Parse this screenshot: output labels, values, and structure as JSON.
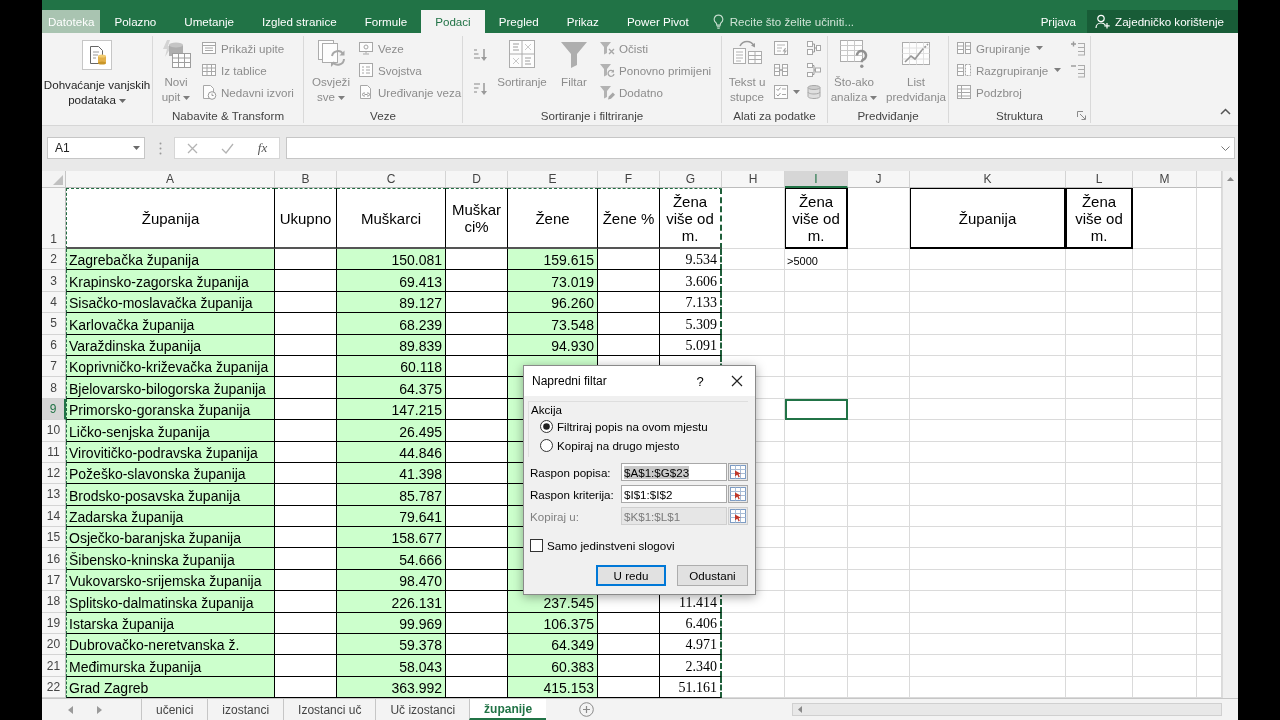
{
  "ribbon_tabs": [
    {
      "label": "Datoteka",
      "kind": "file",
      "selected": false
    },
    {
      "label": "Polazno",
      "kind": "tab",
      "selected": false
    },
    {
      "label": "Umetanje",
      "kind": "tab",
      "selected": false
    },
    {
      "label": "Izgled stranice",
      "kind": "tab",
      "selected": false
    },
    {
      "label": "Formule",
      "kind": "tab",
      "selected": false
    },
    {
      "label": "Podaci",
      "kind": "tab",
      "selected": true
    },
    {
      "label": "Pregled",
      "kind": "tab",
      "selected": false
    },
    {
      "label": "Prikaz",
      "kind": "tab",
      "selected": false
    },
    {
      "label": "Power Pivot",
      "kind": "tab",
      "selected": false
    }
  ],
  "tell_me": {
    "placeholder": "Recite što želite učiniti..."
  },
  "account": {
    "sign_in": "Prijava",
    "share": "Zajedničko korištenje"
  },
  "ribbon": {
    "groups": [
      {
        "dialog_launcher": false,
        "buttons": [
          {
            "kind": "large",
            "label": "Dohvaćanje vanjskih podataka",
            "dropdown": true,
            "disabled": false
          }
        ]
      },
      {
        "label": "Nabavite & Transform",
        "dialog_launcher": false,
        "buttons": [
          {
            "kind": "large",
            "label": "Novi upit",
            "dropdown": true,
            "disabled": true
          },
          {
            "kind": "small",
            "label": "Prikaži upite",
            "dropdown": false,
            "disabled": true
          },
          {
            "kind": "small",
            "label": "Iz tablice",
            "dropdown": false,
            "disabled": true
          },
          {
            "kind": "small",
            "label": "Nedavni izvori",
            "dropdown": false,
            "disabled": true
          }
        ]
      },
      {
        "label": "Veze",
        "dialog_launcher": false,
        "buttons": [
          {
            "kind": "large",
            "label": "Osvježi sve",
            "dropdown": true,
            "disabled": true
          },
          {
            "kind": "small",
            "label": "Veze",
            "dropdown": false,
            "disabled": true
          },
          {
            "kind": "small",
            "label": "Svojstva",
            "dropdown": false,
            "disabled": true
          },
          {
            "kind": "small",
            "label": "Uređivanje veza",
            "dropdown": false,
            "disabled": true
          }
        ]
      },
      {
        "label": "Sortiranje i filtriranje",
        "dialog_launcher": false,
        "buttons": [
          {
            "kind": "icon",
            "dropdown": false,
            "disabled": true
          },
          {
            "kind": "icon",
            "dropdown": false,
            "disabled": true
          },
          {
            "kind": "large",
            "label": "Sortiranje",
            "dropdown": false,
            "disabled": true
          },
          {
            "kind": "large",
            "label": "Filtar",
            "dropdown": false,
            "disabled": true
          },
          {
            "kind": "small",
            "label": "Očisti",
            "dropdown": false,
            "disabled": true
          },
          {
            "kind": "small",
            "label": "Ponovno primijeni",
            "dropdown": false,
            "disabled": true
          },
          {
            "kind": "small",
            "label": "Dodatno",
            "dropdown": false,
            "disabled": true
          }
        ]
      },
      {
        "label": "Alati za podatke",
        "dialog_launcher": false,
        "buttons": [
          {
            "kind": "large",
            "label": "Tekst u stupce",
            "dropdown": false,
            "disabled": true
          },
          {
            "kind": "icon",
            "dropdown": false,
            "disabled": true
          },
          {
            "kind": "icon",
            "dropdown": false,
            "disabled": true
          },
          {
            "kind": "icon",
            "dropdown": true,
            "disabled": true
          },
          {
            "kind": "icon",
            "dropdown": false,
            "disabled": true
          },
          {
            "kind": "icon",
            "dropdown": false,
            "disabled": true
          },
          {
            "kind": "icon",
            "dropdown": false,
            "disabled": true
          }
        ]
      },
      {
        "label": "Predviđanje",
        "dialog_launcher": false,
        "buttons": [
          {
            "kind": "large",
            "label": "Što-ako analiza",
            "dropdown": true,
            "disabled": true
          },
          {
            "kind": "large",
            "label": "List predviđanja",
            "dropdown": false,
            "disabled": true
          }
        ]
      },
      {
        "label": "Struktura",
        "dialog_launcher": true,
        "buttons": [
          {
            "kind": "small",
            "label": "Grupiranje",
            "dropdown": true,
            "disabled": true
          },
          {
            "kind": "small",
            "label": "Razgrupiranje",
            "dropdown": true,
            "disabled": true
          },
          {
            "kind": "small",
            "label": "Podzbroj",
            "dropdown": false,
            "disabled": true
          },
          {
            "kind": "icon",
            "dropdown": false,
            "disabled": true
          },
          {
            "kind": "icon",
            "dropdown": false,
            "disabled": true
          }
        ]
      }
    ]
  },
  "formula_bar": {
    "name_box": "A1",
    "function_label": "fx"
  },
  "sheet": {
    "range_outline": true,
    "columns": [
      {
        "label": "A",
        "kind": "text",
        "selected": false,
        "color": "#ccffcc",
        "bordered": true,
        "header_boxed": false
      },
      {
        "label": "B",
        "kind": "number",
        "selected": false,
        "bordered": true,
        "header_boxed": false
      },
      {
        "label": "C",
        "kind": "number",
        "selected": false,
        "color": "#ccffcc",
        "bordered": true,
        "header_boxed": false
      },
      {
        "label": "D",
        "kind": "number",
        "selected": false,
        "bordered": true,
        "header_boxed": false
      },
      {
        "label": "E",
        "kind": "number",
        "selected": false,
        "color": "#ccffcc",
        "bordered": true,
        "header_boxed": false
      },
      {
        "label": "F",
        "kind": "number",
        "selected": false,
        "bordered": true,
        "header_boxed": false
      },
      {
        "label": "G",
        "kind": "number",
        "selected": false,
        "bordered": true,
        "header_boxed": false
      },
      {
        "label": "H",
        "kind": "text",
        "selected": false,
        "bordered": false,
        "header_boxed": false
      },
      {
        "label": "I",
        "kind": "text",
        "selected": true,
        "bordered": false,
        "header_boxed": true
      },
      {
        "label": "J",
        "kind": "text",
        "selected": false,
        "bordered": false,
        "header_boxed": false
      },
      {
        "label": "K",
        "kind": "text",
        "selected": false,
        "bordered": false,
        "header_boxed": true
      },
      {
        "label": "L",
        "kind": "text",
        "selected": false,
        "bordered": false,
        "header_boxed": true
      },
      {
        "label": "M",
        "kind": "text",
        "selected": false,
        "bordered": false,
        "header_boxed": false
      }
    ],
    "rows": [
      {
        "number": "1",
        "selected": false,
        "cells": [
          "Županija",
          "Ukupno",
          "Muškarci",
          "Muškarci%",
          "Žene",
          "Žene %",
          "Žena više od m.",
          null,
          "Žena više od m.",
          null,
          "Županija",
          "Žena više od m.",
          null
        ]
      },
      {
        "number": "2",
        "selected": false,
        "cells": [
          "Zagrebačka županija",
          null,
          "150.081",
          null,
          "159.615",
          null,
          "9.534",
          null,
          ">5000",
          null,
          null,
          null,
          null
        ]
      },
      {
        "number": "3",
        "selected": false,
        "cells": [
          "Krapinsko-zagorska županija",
          null,
          "69.413",
          null,
          "73.019",
          null,
          "3.606",
          null,
          null,
          null,
          null,
          null,
          null
        ]
      },
      {
        "number": "4",
        "selected": false,
        "cells": [
          "Sisačko-moslavačka županija",
          null,
          "89.127",
          null,
          "96.260",
          null,
          "7.133",
          null,
          null,
          null,
          null,
          null,
          null
        ]
      },
      {
        "number": "5",
        "selected": false,
        "cells": [
          "Karlovačka županija",
          null,
          "68.239",
          null,
          "73.548",
          null,
          "5.309",
          null,
          null,
          null,
          null,
          null,
          null
        ]
      },
      {
        "number": "6",
        "selected": false,
        "cells": [
          "Varaždinska županija",
          null,
          "89.839",
          null,
          "94.930",
          null,
          "5.091",
          null,
          null,
          null,
          null,
          null,
          null
        ]
      },
      {
        "number": "7",
        "selected": false,
        "cells": [
          "Koprivničko-križevačka županija",
          null,
          "60.118",
          null,
          null,
          null,
          null,
          null,
          null,
          null,
          null,
          null,
          null
        ]
      },
      {
        "number": "8",
        "selected": false,
        "cells": [
          "Bjelovarsko-bilogorska županija",
          null,
          "64.375",
          null,
          null,
          null,
          null,
          null,
          null,
          null,
          null,
          null,
          null
        ]
      },
      {
        "number": "9",
        "selected": true,
        "cells": [
          "Primorsko-goranska županija",
          null,
          "147.215",
          null,
          null,
          null,
          null,
          null,
          null,
          null,
          null,
          null,
          null
        ]
      },
      {
        "number": "10",
        "selected": false,
        "cells": [
          "Ličko-senjska županija",
          null,
          "26.495",
          null,
          null,
          null,
          null,
          null,
          null,
          null,
          null,
          null,
          null
        ]
      },
      {
        "number": "11",
        "selected": false,
        "cells": [
          "Virovitičko-podravska županija",
          null,
          "44.846",
          null,
          null,
          null,
          null,
          null,
          null,
          null,
          null,
          null,
          null
        ]
      },
      {
        "number": "12",
        "selected": false,
        "cells": [
          "Požeško-slavonska županija",
          null,
          "41.398",
          null,
          null,
          null,
          null,
          null,
          null,
          null,
          null,
          null,
          null
        ]
      },
      {
        "number": "13",
        "selected": false,
        "cells": [
          "Brodsko-posavska županija",
          null,
          "85.787",
          null,
          null,
          null,
          null,
          null,
          null,
          null,
          null,
          null,
          null
        ]
      },
      {
        "number": "14",
        "selected": false,
        "cells": [
          "Zadarska županija",
          null,
          "79.641",
          null,
          null,
          null,
          null,
          null,
          null,
          null,
          null,
          null,
          null
        ]
      },
      {
        "number": "15",
        "selected": false,
        "cells": [
          "Osječko-baranjska županija",
          null,
          "158.677",
          null,
          null,
          null,
          null,
          null,
          null,
          null,
          null,
          null,
          null
        ]
      },
      {
        "number": "16",
        "selected": false,
        "cells": [
          "Šibensko-kninska županija",
          null,
          "54.666",
          null,
          null,
          null,
          null,
          null,
          null,
          null,
          null,
          null,
          null
        ]
      },
      {
        "number": "17",
        "selected": false,
        "cells": [
          "Vukovarsko-srijemska županija",
          null,
          "98.470",
          null,
          null,
          null,
          null,
          null,
          null,
          null,
          null,
          null,
          null
        ]
      },
      {
        "number": "18",
        "selected": false,
        "cells": [
          "Splitsko-dalmatinska županija",
          null,
          "226.131",
          null,
          "237.545",
          null,
          "11.414",
          null,
          null,
          null,
          null,
          null,
          null
        ]
      },
      {
        "number": "19",
        "selected": false,
        "cells": [
          "Istarska županija",
          null,
          "99.969",
          null,
          "106.375",
          null,
          "6.406",
          null,
          null,
          null,
          null,
          null,
          null
        ]
      },
      {
        "number": "20",
        "selected": false,
        "cells": [
          "Dubrovačko-neretvanska ž.",
          null,
          "59.378",
          null,
          "64.349",
          null,
          "4.971",
          null,
          null,
          null,
          null,
          null,
          null
        ]
      },
      {
        "number": "21",
        "selected": false,
        "cells": [
          "Međimurska županija",
          null,
          "58.043",
          null,
          "60.383",
          null,
          "2.340",
          null,
          null,
          null,
          null,
          null,
          null
        ]
      },
      {
        "number": "22",
        "selected": false,
        "cells": [
          "Grad Zagreb",
          null,
          "363.992",
          null,
          "415.153",
          null,
          "51.161",
          null,
          null,
          null,
          null,
          null,
          null
        ]
      }
    ]
  },
  "sheet_tabs": [
    {
      "label": "učenici",
      "selected": false
    },
    {
      "label": "izostanci",
      "selected": false
    },
    {
      "label": "Izostanci uč",
      "selected": false
    },
    {
      "label": "Uč izostanci",
      "selected": false
    },
    {
      "label": "županije",
      "selected": true
    }
  ],
  "dialog": {
    "title": "Napredni filtar",
    "help_label": "?",
    "section": "Akcija",
    "options": [
      {
        "label": "Filtriraj popis na ovom mjestu",
        "selected": true
      },
      {
        "label": "Kopiraj na drugo mjesto",
        "selected": false
      }
    ],
    "fields": [
      {
        "label": "Raspon popisa:",
        "value": "$A$1:$G$23",
        "disabled": false,
        "text_selected": true
      },
      {
        "label": "Raspon kriterija:",
        "value": "$I$1:$I$2",
        "disabled": false,
        "text_selected": false
      },
      {
        "label": "Kopiraj u:",
        "value": "$K$1:$L$1",
        "disabled": true,
        "text_selected": false
      }
    ],
    "checkbox": {
      "label": "Samo jedinstveni slogovi",
      "checked": false
    },
    "buttons": [
      {
        "label": "U redu",
        "default": true
      },
      {
        "label": "Odustani",
        "default": false
      }
    ]
  }
}
